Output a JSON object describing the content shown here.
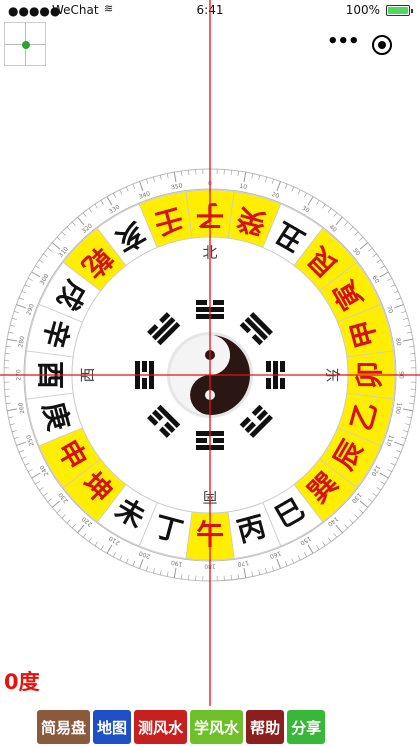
{
  "status_bar": {
    "signal": "●●●●●",
    "carrier": "WeChat",
    "time": "6:41",
    "battery": "100%"
  },
  "header": {
    "menu_icon": "more-dots-icon",
    "close_icon": "target-circle-icon"
  },
  "compass": {
    "ring_chars": [
      "子",
      "癸",
      "丑",
      "艮",
      "寅",
      "甲",
      "卯",
      "乙",
      "辰",
      "巽",
      "巳",
      "丙",
      "午",
      "丁",
      "未",
      "坤",
      "申",
      "庚",
      "酉",
      "辛",
      "戌",
      "乾",
      "亥",
      "壬"
    ],
    "red_chars": [
      "子",
      "癸",
      "艮",
      "寅",
      "甲",
      "卯",
      "乙",
      "辰",
      "巽",
      "午",
      "坤",
      "申",
      "乾",
      "壬"
    ],
    "directions": {
      "north": "北",
      "east": "东",
      "south": "南",
      "west": "西"
    },
    "scale_labels": [
      "0",
      "10",
      "20",
      "30",
      "40",
      "50",
      "60",
      "70",
      "80",
      "90",
      "100",
      "110",
      "120",
      "130",
      "140",
      "150",
      "160",
      "170",
      "180",
      "190",
      "200",
      "210",
      "220",
      "230",
      "240",
      "250",
      "260",
      "270",
      "280",
      "290",
      "300",
      "310",
      "320",
      "330",
      "340",
      "350"
    ],
    "highlight_color": "#ffee00",
    "crosshair_color": "#e8120c"
  },
  "degree": "0度",
  "bottom_buttons": [
    {
      "label": "简易盘",
      "color": "#8b5a3c"
    },
    {
      "label": "地图",
      "color": "#1f4fc4"
    },
    {
      "label": "测风水",
      "color": "#c81f1f"
    },
    {
      "label": "学风水",
      "color": "#6fbf2a"
    },
    {
      "label": "帮助",
      "color": "#8b1f1f"
    },
    {
      "label": "分享",
      "color": "#39b739"
    }
  ]
}
